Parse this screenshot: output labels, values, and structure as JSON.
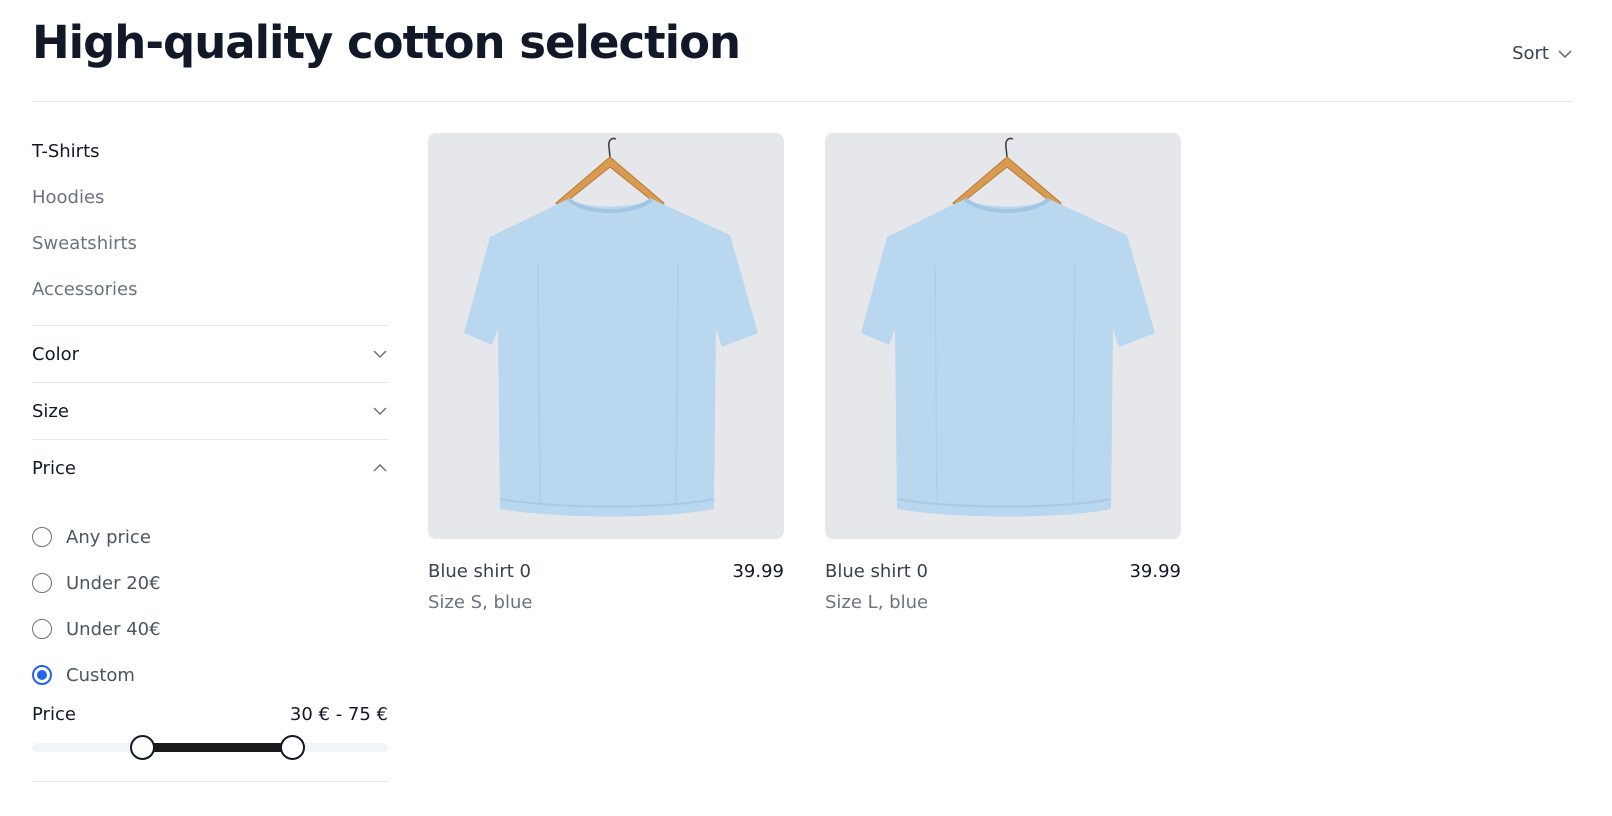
{
  "header": {
    "title": "High-quality cotton selection",
    "sort_label": "Sort"
  },
  "sidebar": {
    "categories": [
      {
        "label": "T-Shirts",
        "active": true
      },
      {
        "label": "Hoodies",
        "active": false
      },
      {
        "label": "Sweatshirts",
        "active": false
      },
      {
        "label": "Accessories",
        "active": false
      }
    ],
    "filters": {
      "color": {
        "label": "Color",
        "expanded": false
      },
      "size": {
        "label": "Size",
        "expanded": false
      },
      "price": {
        "label": "Price",
        "expanded": true,
        "options": [
          {
            "label": "Any price",
            "selected": false
          },
          {
            "label": "Under 20€",
            "selected": false
          },
          {
            "label": "Under 40€",
            "selected": false
          },
          {
            "label": "Custom",
            "selected": true
          }
        ],
        "range": {
          "label": "Price",
          "display": "30 € - 75 €",
          "min_value": 30,
          "max_value": 75,
          "low_fraction": 0.31,
          "high_fraction": 0.73
        }
      }
    }
  },
  "products": [
    {
      "name": "Blue shirt 0",
      "price": "39.99",
      "variant": "Size S, blue",
      "shirt_color": "#b9d7ef"
    },
    {
      "name": "Blue shirt 0",
      "price": "39.99",
      "variant": "Size L, blue",
      "shirt_color": "#b9d7ef"
    }
  ],
  "colors": {
    "accent": "#2563eb",
    "image_bg": "#e5e7eb",
    "hanger": "#d99a52"
  }
}
